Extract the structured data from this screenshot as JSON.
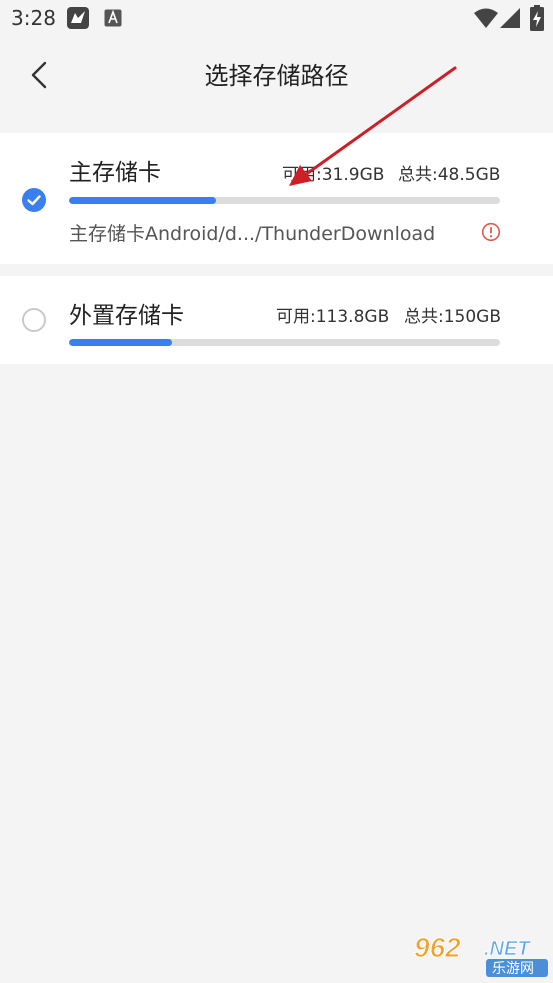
{
  "status_bar": {
    "time": "3:28",
    "icons": [
      "bird-app-icon",
      "a-badge-icon",
      "wifi-icon",
      "signal-icon",
      "battery-charging-icon"
    ]
  },
  "header": {
    "title": "选择存储路径",
    "back_icon": "chevron-left-icon"
  },
  "storage": [
    {
      "name": "主存储卡",
      "available_label": "可用:31.9GB",
      "total_label": "总共:48.5GB",
      "used_fraction": 0.34,
      "path": "主存储卡Android/d.../ThunderDownload",
      "selected": true,
      "warning_icon": "alert-circle-icon"
    },
    {
      "name": "外置存储卡",
      "available_label": "可用:113.8GB",
      "total_label": "总共:150GB",
      "used_fraction": 0.24,
      "selected": false
    }
  ],
  "watermark": {
    "number": "962",
    "suffix": ".NET",
    "chinese": "乐游网"
  },
  "colors": {
    "accent": "#3a7ff0",
    "track": "#dcdcdc",
    "background": "#f4f4f4",
    "warning": "#e05a4f",
    "annotation_arrow": "#cc1f26"
  }
}
